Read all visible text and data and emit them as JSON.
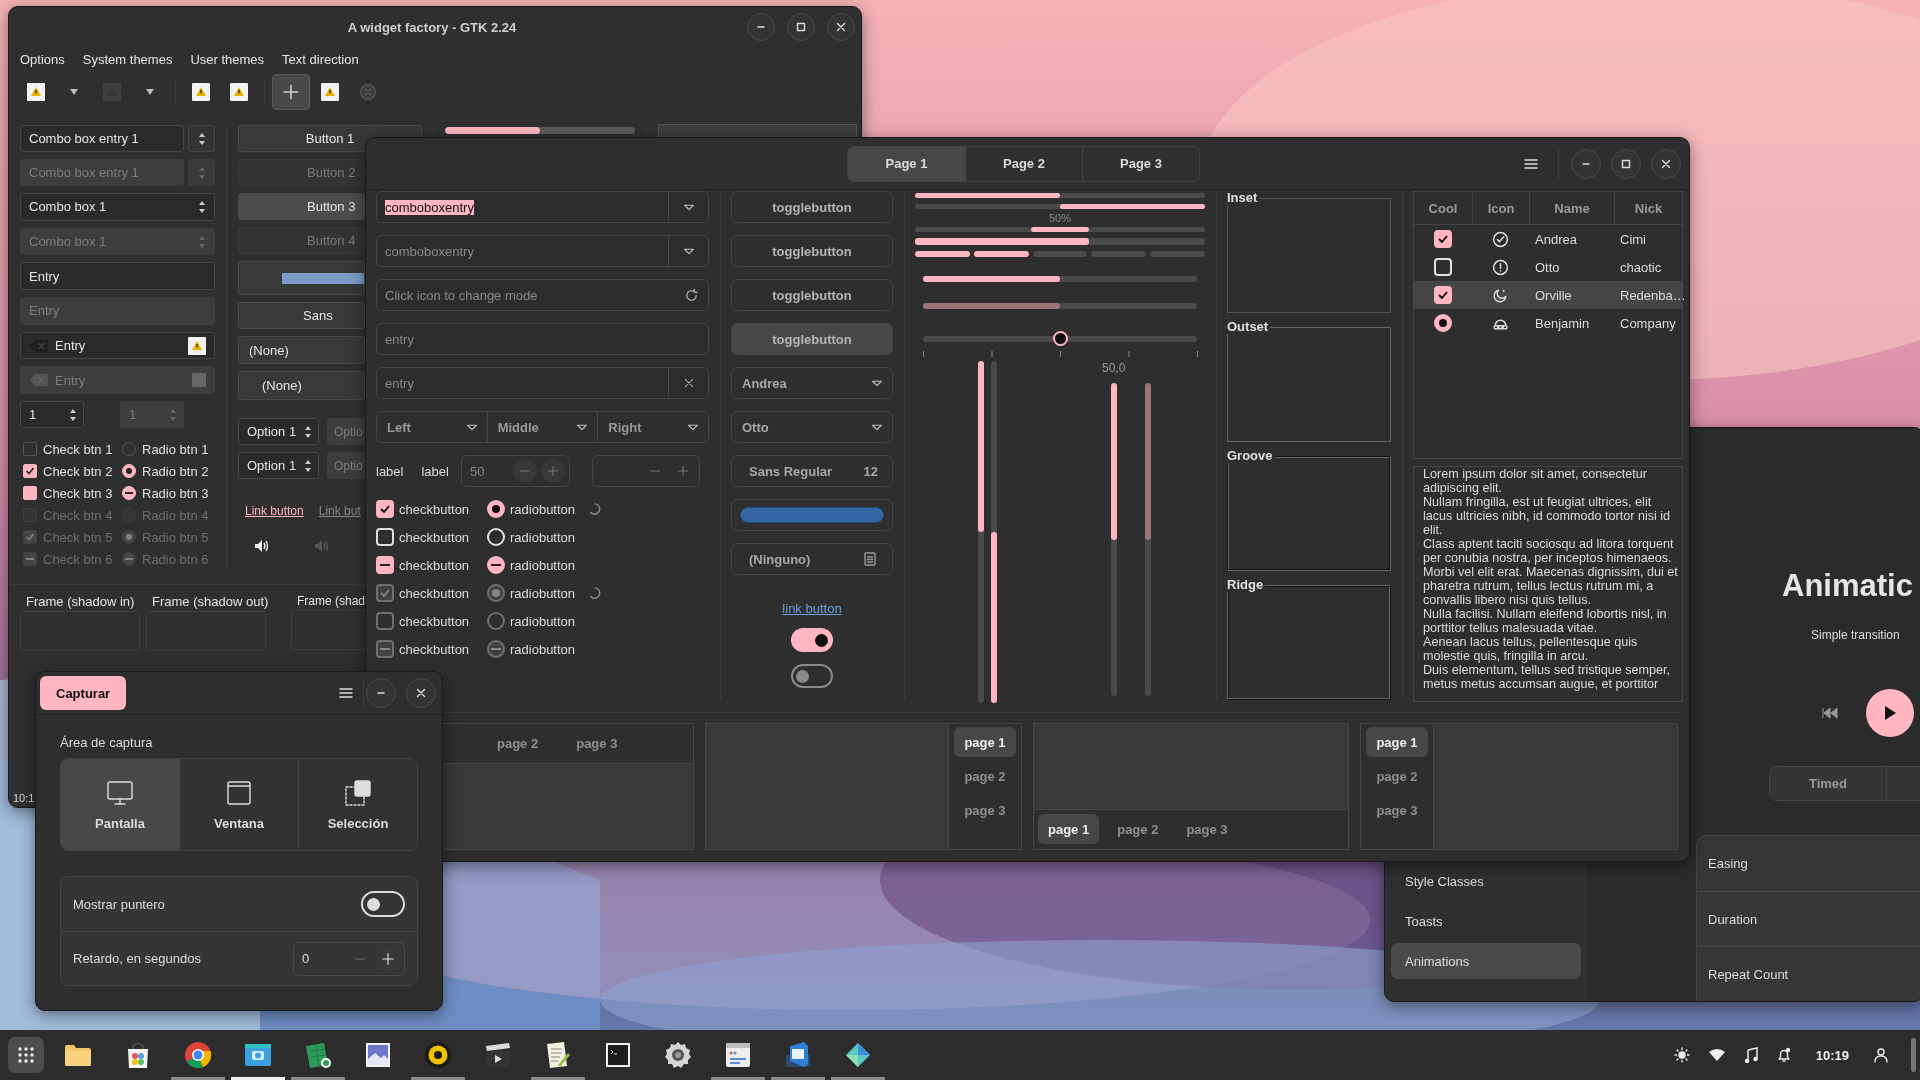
{
  "gtk2_window": {
    "title": "A widget factory - GTK 2.24",
    "menu": [
      "Options",
      "System themes",
      "User themes",
      "Text direction"
    ],
    "toolbar": [
      {
        "kind": "warning",
        "disabled": false
      },
      {
        "kind": "arrow",
        "disabled": false
      },
      {
        "kind": "warning",
        "disabled": true
      },
      {
        "kind": "arrow",
        "disabled": false
      },
      {
        "kind": "separator"
      },
      {
        "kind": "warning",
        "disabled": false
      },
      {
        "kind": "warning",
        "disabled": false
      },
      {
        "kind": "separator"
      },
      {
        "kind": "add",
        "disabled": false
      },
      {
        "kind": "warning",
        "disabled": false
      },
      {
        "kind": "stop",
        "disabled": true
      }
    ],
    "fields": [
      {
        "kind": "combo_entry",
        "text": "Combo box entry 1",
        "disabled": false
      },
      {
        "kind": "combo_entry",
        "text": "Combo box entry 1",
        "disabled": true
      },
      {
        "kind": "combo",
        "text": "Combo box 1",
        "disabled": false
      },
      {
        "kind": "combo",
        "text": "Combo box 1",
        "disabled": true
      },
      {
        "kind": "entry",
        "text": "Entry",
        "disabled": false
      },
      {
        "kind": "entry",
        "text": "Entry",
        "disabled": true
      },
      {
        "kind": "icon_entry",
        "text": "Entry",
        "disabled": false
      },
      {
        "kind": "icon_entry",
        "text": "Entry",
        "disabled": true
      }
    ],
    "spins": [
      {
        "value": "1",
        "disabled": false
      },
      {
        "value": "1",
        "disabled": true
      }
    ],
    "checks": [
      {
        "label": "Check btn 1",
        "checked": false,
        "inconsistent": false,
        "disabled": false
      },
      {
        "label": "Check btn 2",
        "checked": true,
        "inconsistent": false,
        "disabled": false
      },
      {
        "label": "Check btn 3",
        "checked": true,
        "inconsistent": true,
        "disabled": false
      },
      {
        "label": "Check btn 4",
        "checked": false,
        "inconsistent": false,
        "disabled": true
      },
      {
        "label": "Check btn 5",
        "checked": true,
        "inconsistent": false,
        "disabled": true
      },
      {
        "label": "Check btn 6",
        "checked": true,
        "inconsistent": true,
        "disabled": true
      }
    ],
    "radios": [
      {
        "label": "Radio btn 1",
        "checked": false,
        "inconsistent": false,
        "disabled": false
      },
      {
        "label": "Radio btn 2",
        "checked": true,
        "inconsistent": false,
        "disabled": false
      },
      {
        "label": "Radio btn 3",
        "checked": true,
        "inconsistent": true,
        "disabled": false
      },
      {
        "label": "Radio btn 4",
        "checked": false,
        "inconsistent": false,
        "disabled": true
      },
      {
        "label": "Radio btn 5",
        "checked": true,
        "inconsistent": false,
        "disabled": true
      },
      {
        "label": "Radio btn 6",
        "checked": true,
        "inconsistent": true,
        "disabled": true
      }
    ],
    "buttons": [
      {
        "label": "Button 1",
        "disabled": false,
        "pressed": false
      },
      {
        "label": "Button 2",
        "disabled": true,
        "pressed": false
      },
      {
        "label": "Button 3",
        "disabled": false,
        "pressed": true
      },
      {
        "label": "Button 4",
        "disabled": true,
        "pressed": false
      }
    ],
    "font_button": "Sans",
    "file_button": "(None)",
    "combo": "(None)",
    "option_spins": [
      {
        "value": "Option 1",
        "disabled": false
      },
      {
        "value": "Optio",
        "disabled": true
      },
      {
        "value": "Option 1",
        "disabled": false
      },
      {
        "value": "Optio",
        "disabled": true
      }
    ],
    "links": [
      {
        "label": "Link button",
        "disabled": false
      },
      {
        "label": "Link but",
        "disabled": true
      }
    ],
    "volume": [
      {
        "disabled": false
      },
      {
        "disabled": true
      }
    ],
    "progress": {
      "level": 0.5
    },
    "frames": [
      "Frame (shadow in)",
      "Frame (shadow out)",
      "Frame (shad"
    ],
    "status": "10:1"
  },
  "main_window": {
    "tabs": [
      {
        "label": "Page 1",
        "selected": true
      },
      {
        "label": "Page 2",
        "selected": false
      },
      {
        "label": "Page 3",
        "selected": false
      }
    ],
    "fields": [
      {
        "kind": "combo_entry",
        "value": "comboboxentry",
        "text_selected": true
      },
      {
        "kind": "combo_entry",
        "placeholder": "comboboxentry"
      },
      {
        "kind": "mode_entry",
        "placeholder": "Click icon to change mode"
      },
      {
        "kind": "entry",
        "placeholder": "entry"
      },
      {
        "kind": "clear_entry",
        "placeholder": "entry"
      }
    ],
    "linked_combos": [
      "Left",
      "Middle",
      "Right"
    ],
    "labels": [
      "label",
      "label"
    ],
    "spins": [
      {
        "kind": "value",
        "value": "50"
      },
      {
        "kind": "blank"
      }
    ],
    "check_rows": [
      {
        "check": {
          "checked": true,
          "inconsistent": false,
          "disabled": false
        },
        "check_label": "checkbutton",
        "radio": {
          "checked": true,
          "inconsistent": false,
          "disabled": false
        },
        "radio_label": "radiobutton",
        "spinner": true
      },
      {
        "check": {
          "checked": false,
          "inconsistent": false,
          "disabled": false
        },
        "check_label": "checkbutton",
        "radio": {
          "checked": false,
          "inconsistent": false,
          "disabled": false
        },
        "radio_label": "radiobutton",
        "spinner": false
      },
      {
        "check": {
          "checked": true,
          "inconsistent": true,
          "disabled": false
        },
        "check_label": "checkbutton",
        "radio": {
          "checked": true,
          "inconsistent": true,
          "disabled": false
        },
        "radio_label": "radiobutton",
        "spinner": false
      },
      {
        "check": {
          "checked": true,
          "inconsistent": false,
          "disabled": true
        },
        "check_label": "checkbutton",
        "radio": {
          "checked": true,
          "inconsistent": false,
          "disabled": true
        },
        "radio_label": "radiobutton",
        "spinner": true
      },
      {
        "check": {
          "checked": false,
          "inconsistent": false,
          "disabled": true
        },
        "check_label": "checkbutton",
        "radio": {
          "checked": false,
          "inconsistent": false,
          "disabled": true
        },
        "radio_label": "radiobutton",
        "spinner": false
      },
      {
        "check": {
          "checked": true,
          "inconsistent": true,
          "disabled": true
        },
        "check_label": "checkbutton",
        "radio": {
          "checked": true,
          "inconsistent": true,
          "disabled": true
        },
        "radio_label": "radiobutton",
        "spinner": false
      }
    ],
    "toggles": [
      {
        "label": "togglebutton",
        "active": false
      },
      {
        "label": "togglebutton",
        "active": false
      },
      {
        "label": "togglebutton",
        "active": false
      },
      {
        "label": "togglebutton",
        "active": true
      }
    ],
    "combos": [
      "Andrea",
      "Otto"
    ],
    "font_button": {
      "family": "Sans Regular",
      "size": "12"
    },
    "file_button": "(Ninguno)",
    "link": "link button",
    "switches": [
      {
        "on": true
      },
      {
        "on": false
      }
    ],
    "progress_bars": [
      {
        "kind": "plain",
        "level": 0.5
      },
      {
        "kind": "inverted",
        "level": 0.5
      },
      {
        "kind": "pulse",
        "text": "50%"
      },
      {
        "kind": "thick",
        "level": 0.6
      },
      {
        "kind": "segmented",
        "level": 0.4
      }
    ],
    "scales": [
      {
        "kind": "plain",
        "level": 0.5,
        "disabled": false
      },
      {
        "kind": "plain",
        "level": 0.5,
        "disabled": true
      },
      {
        "kind": "marks",
        "level": 0.5,
        "disabled": false
      }
    ],
    "vscales": [
      {
        "level": 0.5,
        "inverted": false,
        "disabled": false
      },
      {
        "level": 0.5,
        "inverted": true,
        "disabled": false
      },
      {
        "level": 0.5,
        "inverted": false,
        "disabled": false,
        "value": "50,0"
      },
      {
        "level": 0.5,
        "inverted": false,
        "disabled": true
      }
    ],
    "frames": [
      "Inset",
      "Outset",
      "Groove",
      "Ridge"
    ],
    "tree": {
      "columns": [
        "Cool",
        "Icon",
        "Name",
        "Nick"
      ],
      "rows": [
        {
          "kind": "check",
          "checked": true,
          "name": "Andrea",
          "nick": "Cimi",
          "selected": false
        },
        {
          "kind": "check",
          "checked": false,
          "name": "Otto",
          "nick": "chaotic",
          "selected": false
        },
        {
          "kind": "check",
          "checked": true,
          "name": "Orville",
          "nick": "Redenba…",
          "selected": true
        },
        {
          "kind": "radio",
          "checked": true,
          "name": "Benjamin",
          "nick": "Company",
          "selected": false
        }
      ]
    },
    "text": [
      "Lorem ipsum dolor sit amet, consectetur adipiscing elit.",
      "Nullam fringilla, est ut feugiat ultrices, elit lacus ultricies nibh, id commodo tortor nisi id elit.",
      "Class aptent taciti sociosqu ad litora torquent per conubia nostra, per inceptos himenaeos.",
      "Morbi vel elit erat. Maecenas dignissim, dui et pharetra rutrum, tellus lectus rutrum mi, a convallis libero nisi quis tellus.",
      "Nulla facilisi. Nullam eleifend lobortis nisl, in porttitor tellus malesuada vitae.",
      "Aenean lacus tellus, pellentesque quis molestie quis, fringilla in arcu.",
      "Duis elementum, tellus sed tristique semper, metus metus accumsan augue, et porttitor"
    ],
    "notebooks": [
      {
        "kind": "top",
        "tabs": [
          {
            "label": "page 2",
            "selected": false
          },
          {
            "label": "page 3",
            "selected": false
          }
        ]
      },
      {
        "kind": "right",
        "tabs": [
          {
            "label": "page 1",
            "selected": true
          },
          {
            "label": "page 2",
            "selected": false
          },
          {
            "label": "page 3",
            "selected": false
          }
        ]
      },
      {
        "kind": "bottom",
        "tabs": [
          {
            "label": "page 1",
            "selected": true
          },
          {
            "label": "page 2",
            "selected": false
          },
          {
            "label": "page 3",
            "selected": false
          }
        ]
      },
      {
        "kind": "left",
        "tabs": [
          {
            "label": "page 1",
            "selected": true
          },
          {
            "label": "page 2",
            "selected": false
          },
          {
            "label": "page 3",
            "selected": false
          }
        ]
      }
    ]
  },
  "capture_dialog": {
    "button": "Capturar",
    "section": "Área de captura",
    "modes": [
      {
        "label": "Pantalla",
        "selected": true
      },
      {
        "label": "Ventana",
        "selected": false
      },
      {
        "label": "Selección",
        "selected": false
      }
    ],
    "options": [
      {
        "kind": "switch",
        "label": "Mostrar puntero",
        "on": false
      },
      {
        "kind": "spin",
        "label": "Retardo, en segundos",
        "value": "0"
      }
    ]
  },
  "demo_window": {
    "sidebar": [
      {
        "label": "Style Classes",
        "selected": false
      },
      {
        "label": "Toasts",
        "selected": false
      },
      {
        "label": "Animations",
        "selected": true
      }
    ],
    "title": "Animatic",
    "subtitle": "Simple transition",
    "segments": [
      {
        "label": "Timed",
        "selected": false
      }
    ],
    "rows": [
      "Easing",
      "Duration",
      "Repeat Count"
    ]
  },
  "taskbar": {
    "apps": [
      {
        "running": false,
        "focused": false
      },
      {
        "running": false,
        "focused": false
      },
      {
        "running": true,
        "focused": false
      },
      {
        "running": true,
        "focused": true
      },
      {
        "running": true,
        "focused": false
      },
      {
        "running": false,
        "focused": false
      },
      {
        "running": true,
        "focused": false
      },
      {
        "running": false,
        "focused": false
      },
      {
        "running": true,
        "focused": false
      },
      {
        "running": false,
        "focused": false
      },
      {
        "running": false,
        "focused": false
      },
      {
        "running": true,
        "focused": false
      },
      {
        "running": true,
        "focused": false
      },
      {
        "running": true,
        "focused": false
      }
    ],
    "clock": "10:19"
  }
}
